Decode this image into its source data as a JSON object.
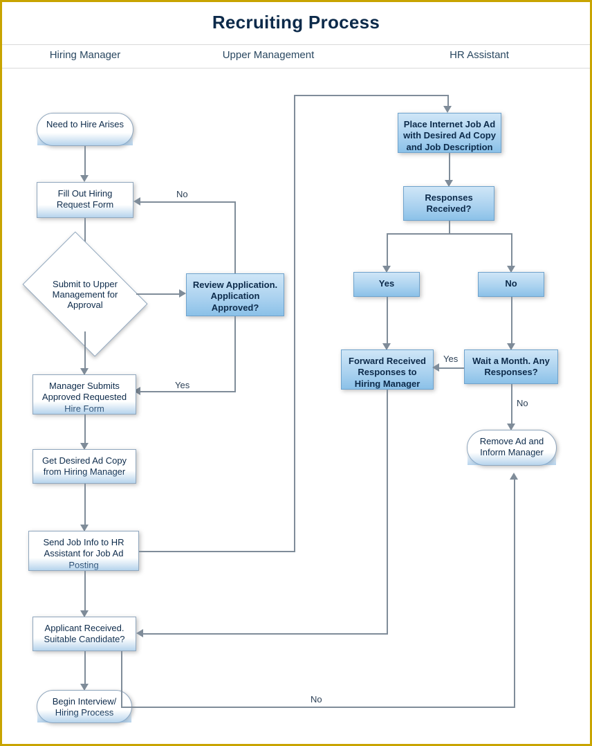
{
  "title": "Recruiting Process",
  "lanes": {
    "l1": "Hiring Manager",
    "l2": "Upper Management",
    "l3": "HR Assistant"
  },
  "nodes": {
    "needHire": "Need to Hire Arises",
    "fillForm": "Fill Out Hiring Request Form",
    "submit": "Submit to Upper Management for Approval",
    "review": "Review Application. Application Approved?",
    "managerSubmits": "Manager Submits Approved Requested Hire Form",
    "getCopy": "Get Desired Ad Copy from Hiring Manager",
    "sendInfo": "Send Job Info to HR Assistant for Job Ad Posting",
    "applicant": "Applicant Received. Suitable Candidate?",
    "beginHire": "Begin Interview/ Hiring Process",
    "placeAd": "Place Internet Job Ad with Desired Ad Copy and Job Description",
    "responses": "Responses Received?",
    "yes": "Yes",
    "no": "No",
    "forward": "Forward Received Responses to Hiring Manager",
    "wait": "Wait a Month. Any Responses?",
    "remove": "Remove Ad and Inform Manager"
  },
  "labels": {
    "no": "No",
    "yes": "Yes"
  }
}
